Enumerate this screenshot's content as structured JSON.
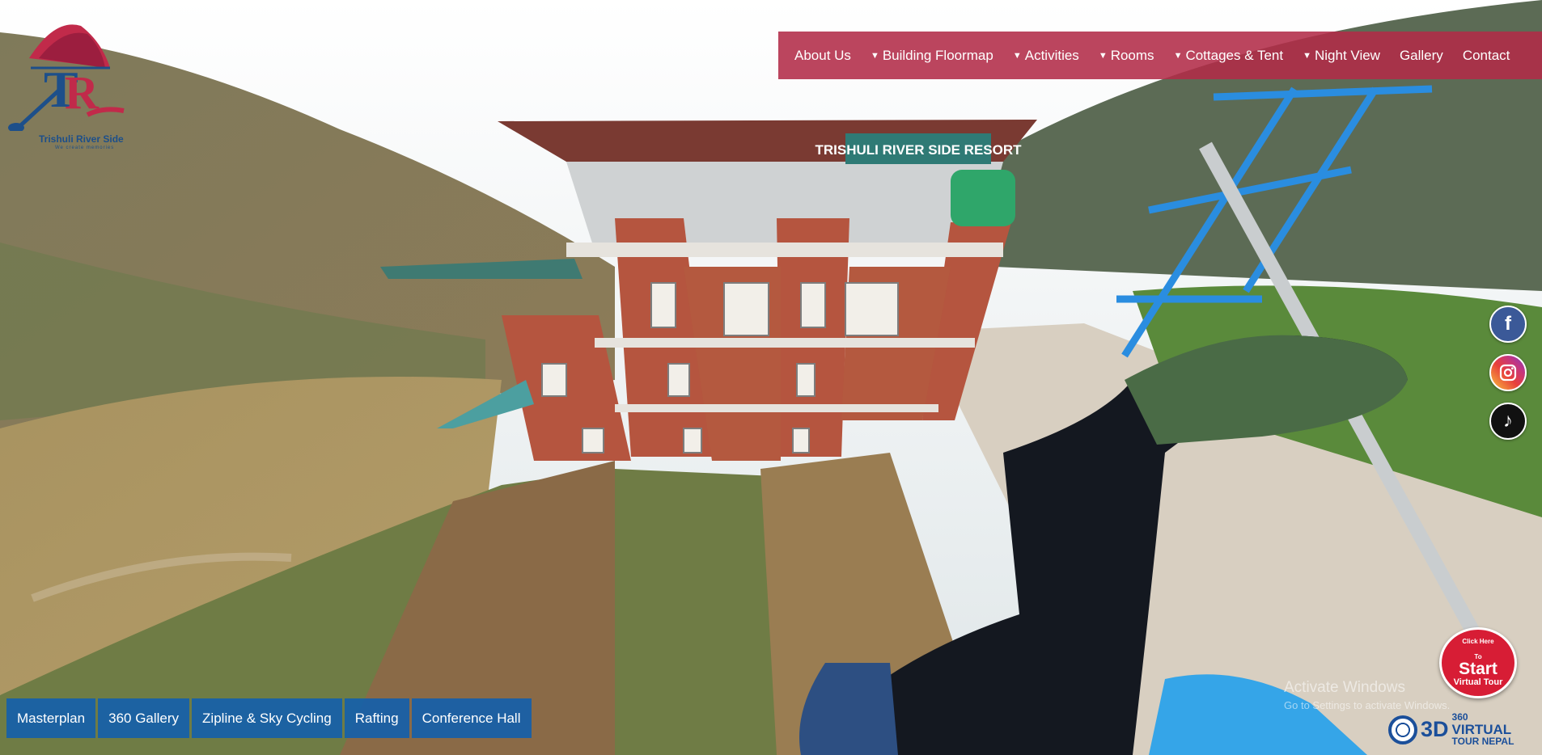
{
  "logo": {
    "name": "Trishuli River Side",
    "tagline": "We create memories"
  },
  "scene": {
    "building_sign": "TRISHULI RIVER SIDE RESORT"
  },
  "topnav": {
    "items": [
      {
        "label": "About Us",
        "dropdown": false
      },
      {
        "label": "Building Floormap",
        "dropdown": true
      },
      {
        "label": "Activities",
        "dropdown": true
      },
      {
        "label": "Rooms",
        "dropdown": true
      },
      {
        "label": "Cottages & Tent",
        "dropdown": true
      },
      {
        "label": "Night View",
        "dropdown": true
      },
      {
        "label": "Gallery",
        "dropdown": false
      },
      {
        "label": "Contact",
        "dropdown": false
      }
    ],
    "caret": "▼"
  },
  "social": {
    "facebook": "f",
    "tiktok": "♪"
  },
  "bottomnav": {
    "items": [
      "Masterplan",
      "360 Gallery",
      "Zipline & Sky Cycling",
      "Rafting",
      "Conference Hall"
    ]
  },
  "start_badge": {
    "line1": "Click Here",
    "line2": "To",
    "line3": "Start",
    "line4": "Virtual Tour"
  },
  "watermark": {
    "title": "Activate Windows",
    "subtitle": "Go to Settings to activate Windows."
  },
  "brand": {
    "prefix": "3D",
    "superscript": "360",
    "line1": "VIRTUAL",
    "line2": "TOUR NEPAL"
  },
  "colors": {
    "nav_bg": "#b22b48",
    "bottom_nav_bg": "#155faa",
    "badge_red": "#d71d35",
    "brand_blue": "#1b4f9a"
  }
}
